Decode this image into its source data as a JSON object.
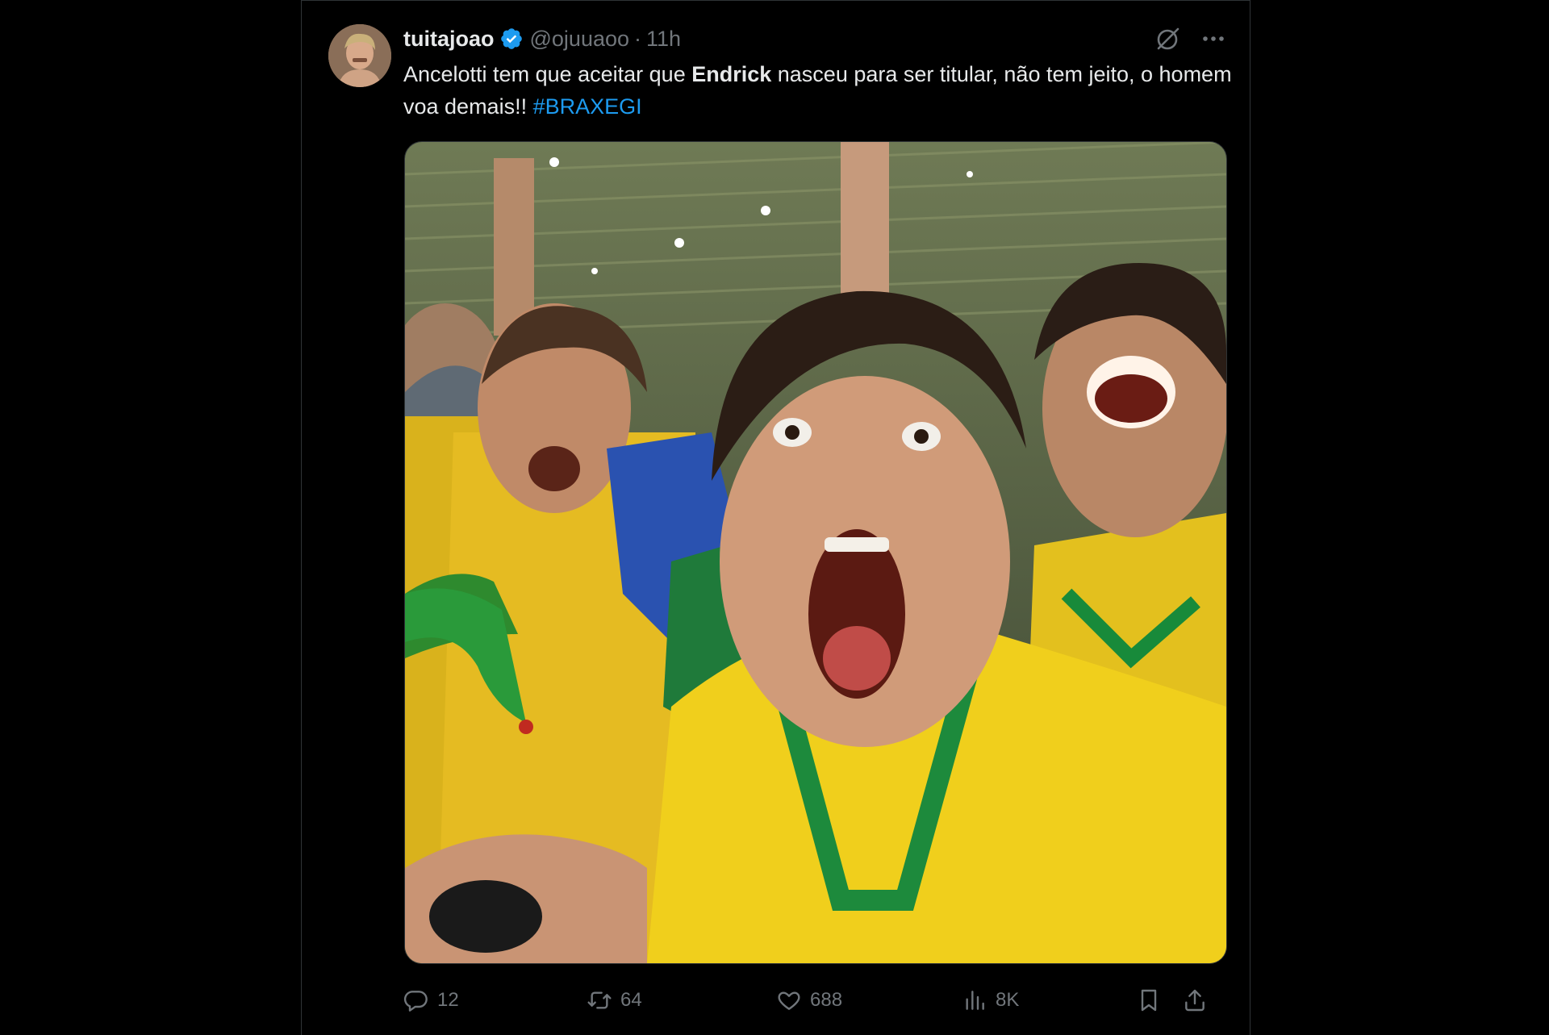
{
  "tweet": {
    "display_name": "tuitajoao",
    "handle": "@ojuuaoo",
    "separator": "·",
    "time": "11h",
    "text_part1": "Ancelotti tem que aceitar que ",
    "text_bold": "Endrick",
    "text_part2": " nasceu para ser titular, não tem jeito, o homem voa demais!! ",
    "hashtag": "#BRAXEGI",
    "image_alt": "Torcedores brasileiros comemorando com camisas amarelas",
    "avatar_alt": "avatar"
  },
  "actions": {
    "replies": "12",
    "reposts": "64",
    "likes": "688",
    "views": "8K"
  },
  "colors": {
    "background": "#000000",
    "text": "#e7e9ea",
    "muted": "#71767b",
    "accent": "#1d9bf0",
    "border": "#2f3336"
  },
  "icons": {
    "verified": "verified-badge-icon",
    "grok": "grok-icon",
    "more": "more-icon",
    "reply": "reply-icon",
    "retweet": "retweet-icon",
    "like": "heart-icon",
    "views": "views-icon",
    "bookmark": "bookmark-icon",
    "share": "share-icon"
  }
}
